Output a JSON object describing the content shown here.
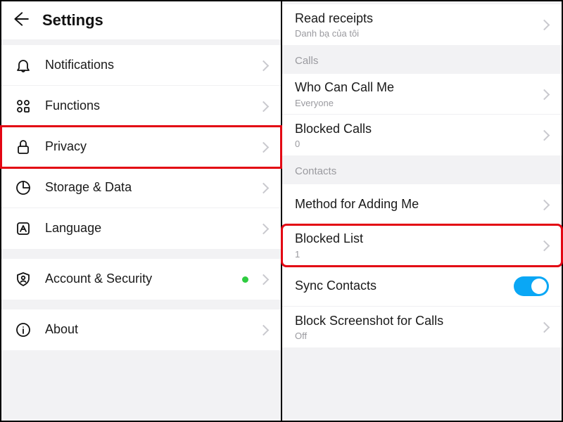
{
  "left": {
    "title": "Settings",
    "items": {
      "notifications": "Notifications",
      "functions": "Functions",
      "privacy": "Privacy",
      "storage": "Storage & Data",
      "language": "Language",
      "account": "Account & Security",
      "about": "About"
    }
  },
  "right": {
    "read_receipts": {
      "label": "Read receipts",
      "sub": "Danh bạ của tôi"
    },
    "section_calls": "Calls",
    "who_can_call": {
      "label": "Who Can Call Me",
      "sub": "Everyone"
    },
    "blocked_calls": {
      "label": "Blocked Calls",
      "sub": "0"
    },
    "section_contacts": "Contacts",
    "method_add": {
      "label": "Method for Adding Me"
    },
    "blocked_list": {
      "label": "Blocked List",
      "sub": "1"
    },
    "sync_contacts": {
      "label": "Sync Contacts"
    },
    "block_screenshot": {
      "label": "Block Screenshot for Calls",
      "sub": "Off"
    }
  }
}
